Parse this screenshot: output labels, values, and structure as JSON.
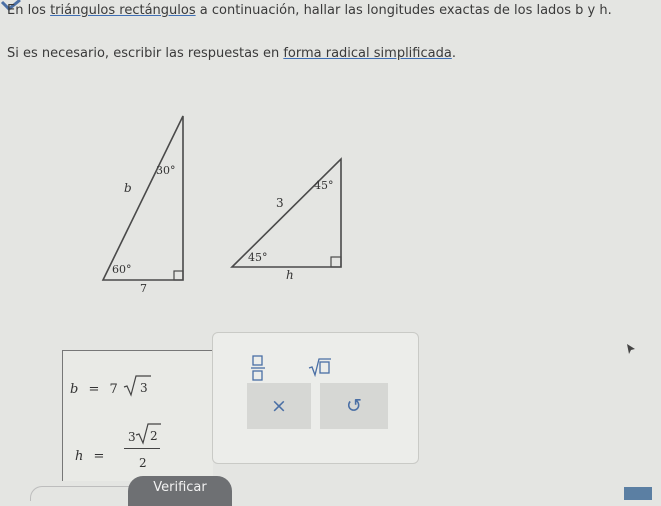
{
  "instructions": {
    "line1_prefix": "En los ",
    "line1_link": "triángulos rectángulos",
    "line1_suffix": " a continuación, hallar las longitudes exactas de los lados b y h.",
    "line2_prefix": "Si es necesario, escribir las respuestas en ",
    "line2_link": "forma radical simplificada",
    "line2_suffix": "."
  },
  "triangle1": {
    "angle_top": "30°",
    "angle_bottom": "60°",
    "side_label": "b",
    "base_label": "7"
  },
  "triangle2": {
    "angle_top": "45°",
    "angle_bottom": "45°",
    "side_label": "3",
    "base_label": "h"
  },
  "answers": {
    "b": {
      "var": "b",
      "eq": "=",
      "coef": "7",
      "radicand": "3"
    },
    "h": {
      "var": "h",
      "eq": "=",
      "num_coef": "3",
      "radicand": "2",
      "denominator": "2"
    }
  },
  "toolbar": {
    "clear_symbol": "×",
    "undo_symbol": "↺"
  },
  "verify_label": "Verificar",
  "colors": {
    "accent": "#4a6fa5",
    "button_dark": "#6e7073",
    "background": "#e4e5e2"
  }
}
